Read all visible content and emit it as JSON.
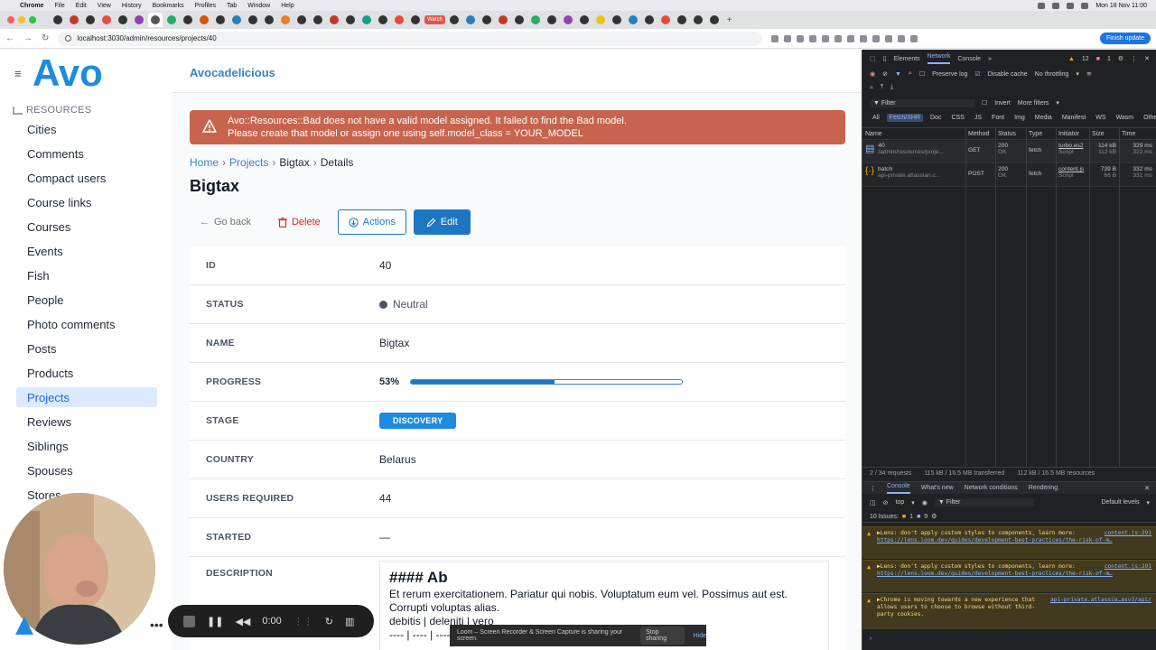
{
  "menubar": {
    "app": "Chrome",
    "items": [
      "File",
      "Edit",
      "View",
      "History",
      "Bookmarks",
      "Profiles",
      "Tab",
      "Window",
      "Help"
    ],
    "clock": "Mon 18 Nov 11:00"
  },
  "tabs": {
    "watch_label": "Watch"
  },
  "browser": {
    "url": "localhost:3030/admin/resources/projects/40",
    "finish_update": "Finish update"
  },
  "app": {
    "name": "Avocadelicious",
    "logo_text": "Avo",
    "resources_heading": "RESOURCES",
    "sidebar": [
      "Cities",
      "Comments",
      "Compact users",
      "Course links",
      "Courses",
      "Events",
      "Fish",
      "People",
      "Photo comments",
      "Posts",
      "Products",
      "Projects",
      "Reviews",
      "Siblings",
      "Spouses",
      "Stores"
    ],
    "active_item": "Projects"
  },
  "alert": {
    "line1": "Avo::Resources::Bad does not have a valid model assigned. It failed to find the Bad model.",
    "line2": "Please create that model or assign one using self.model_class = YOUR_MODEL"
  },
  "breadcrumb": {
    "home": "Home",
    "projects": "Projects",
    "record": "Bigtax",
    "current": "Details"
  },
  "page_title": "Bigtax",
  "actions": {
    "back": "Go back",
    "delete": "Delete",
    "actions": "Actions",
    "edit": "Edit"
  },
  "fields": {
    "id": {
      "label": "ID",
      "value": "40"
    },
    "status": {
      "label": "STATUS",
      "value": "Neutral"
    },
    "name": {
      "label": "NAME",
      "value": "Bigtax"
    },
    "progress": {
      "label": "PROGRESS",
      "value": "53%",
      "fraction": 0.53
    },
    "stage": {
      "label": "STAGE",
      "value": "DISCOVERY"
    },
    "country": {
      "label": "COUNTRY",
      "value": "Belarus"
    },
    "users_required": {
      "label": "USERS REQUIRED",
      "value": "44"
    },
    "started": {
      "label": "STARTED",
      "value": "—"
    },
    "description": {
      "label": "DESCRIPTION",
      "heading": "#### Ab",
      "line1": "Et rerum exercitationem. Pariatur qui nobis. Voluptatum eum vel. Possimus aut est.",
      "line2": "Corrupti voluptas alias.",
      "line3": "debitis | deleniti | vero",
      "line4": "---- | ---- | ----"
    }
  },
  "loom": {
    "timer": "0:00",
    "share_text": "Loom – Screen Recorder & Screen Capture is sharing your screen.",
    "stop": "Stop sharing",
    "hide": "Hide"
  },
  "devtools": {
    "tabs": [
      "Elements",
      "Network",
      "Console"
    ],
    "active_tab": "Network",
    "warn_count": "12",
    "err_count": "1",
    "preserve_log": "Preserve log",
    "disable_cache": "Disable cache",
    "throttle": "No throttling",
    "filter": "Filter",
    "invert": "Invert",
    "more_filters": "More filters",
    "type_chips": [
      "All",
      "Fetch/XHR",
      "Doc",
      "CSS",
      "JS",
      "Font",
      "Img",
      "Media",
      "Manifest",
      "WS",
      "Wasm",
      "Other"
    ],
    "columns": [
      "Name",
      "Method",
      "Status",
      "Type",
      "Initiator",
      "Size",
      "Time"
    ],
    "requests": [
      {
        "name": "40",
        "path": "/admin/resources/proje...",
        "method": "GET",
        "status": "200",
        "status_text": "OK",
        "type": "fetch",
        "initiator": "turbo.es2",
        "initiator_sub": "Script",
        "size": "114 kB",
        "size_sub": "112 kB",
        "time": "329 ms",
        "time_sub": "322 ms"
      },
      {
        "name": "batch",
        "path": "api-private.atlassian.c...",
        "method": "POST",
        "status": "200",
        "status_text": "OK",
        "type": "fetch",
        "initiator": "content.js",
        "initiator_sub": "Script",
        "size": "739 B",
        "size_sub": "66 B",
        "time": "332 ms",
        "time_sub": "331 ms"
      }
    ],
    "summary": [
      "2 / 34 requests",
      "115 kB / 16.5 MB transferred",
      "112 kB / 16.5 MB resources"
    ],
    "drawer_tabs": [
      "Console",
      "What's new",
      "Network conditions",
      "Rendering"
    ],
    "console_context": "top",
    "default_levels": "Default levels",
    "issues": "10 Issues:",
    "issues_warn": "1",
    "issues_info": "9",
    "messages": [
      {
        "text": "▶Lens: don't apply custom styles to components, learn more:",
        "link": "https://lens.loom.dev/guides/development-best-practices/the-risk-of-m…",
        "src": "content.js:291"
      },
      {
        "text": "▶Lens: don't apply custom styles to components, learn more:",
        "link": "https://lens.loom.dev/guides/development-best-practices/the-risk-of-m…",
        "src": "content.js:291"
      },
      {
        "text": "▶Chrome is moving towards a new experience that allows users to choose to browse without third-party cookies.",
        "link": "",
        "src": "api-private.atlassia…asv3/api/v1/batch:1"
      }
    ]
  }
}
